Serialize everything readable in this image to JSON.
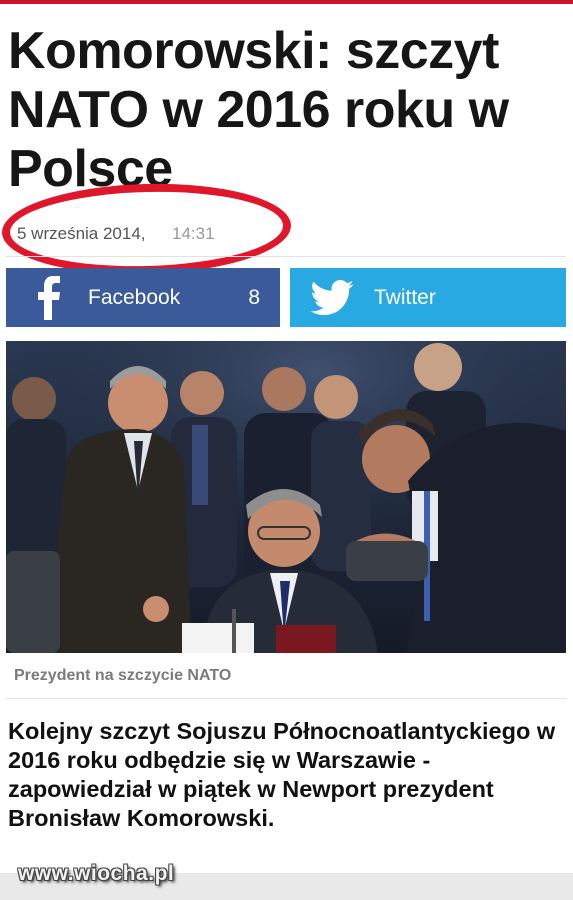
{
  "article": {
    "title": "Komorowski: szczyt NATO w 2016 roku w Polsce",
    "date": "5 września 2014,",
    "time": "14:31",
    "photo_caption": "Prezydent na szczycie NATO",
    "lead": "Kolejny szczyt Sojuszu Północnoatlantyckiego w 2016 roku odbędzie się w Warszawie - zapowiedział w piątek w Newport prezydent Bronisław Komorowski."
  },
  "share": {
    "facebook": {
      "label": "Facebook",
      "count": "8",
      "icon": "facebook-f-icon",
      "color": "#3b5a9a"
    },
    "twitter": {
      "label": "Twitter",
      "icon": "twitter-bird-icon",
      "color": "#29a9e1"
    }
  },
  "annotation": {
    "color": "#e0162b",
    "shape": "red-oval-around-date"
  },
  "watermark": "www.wiocha.pl"
}
